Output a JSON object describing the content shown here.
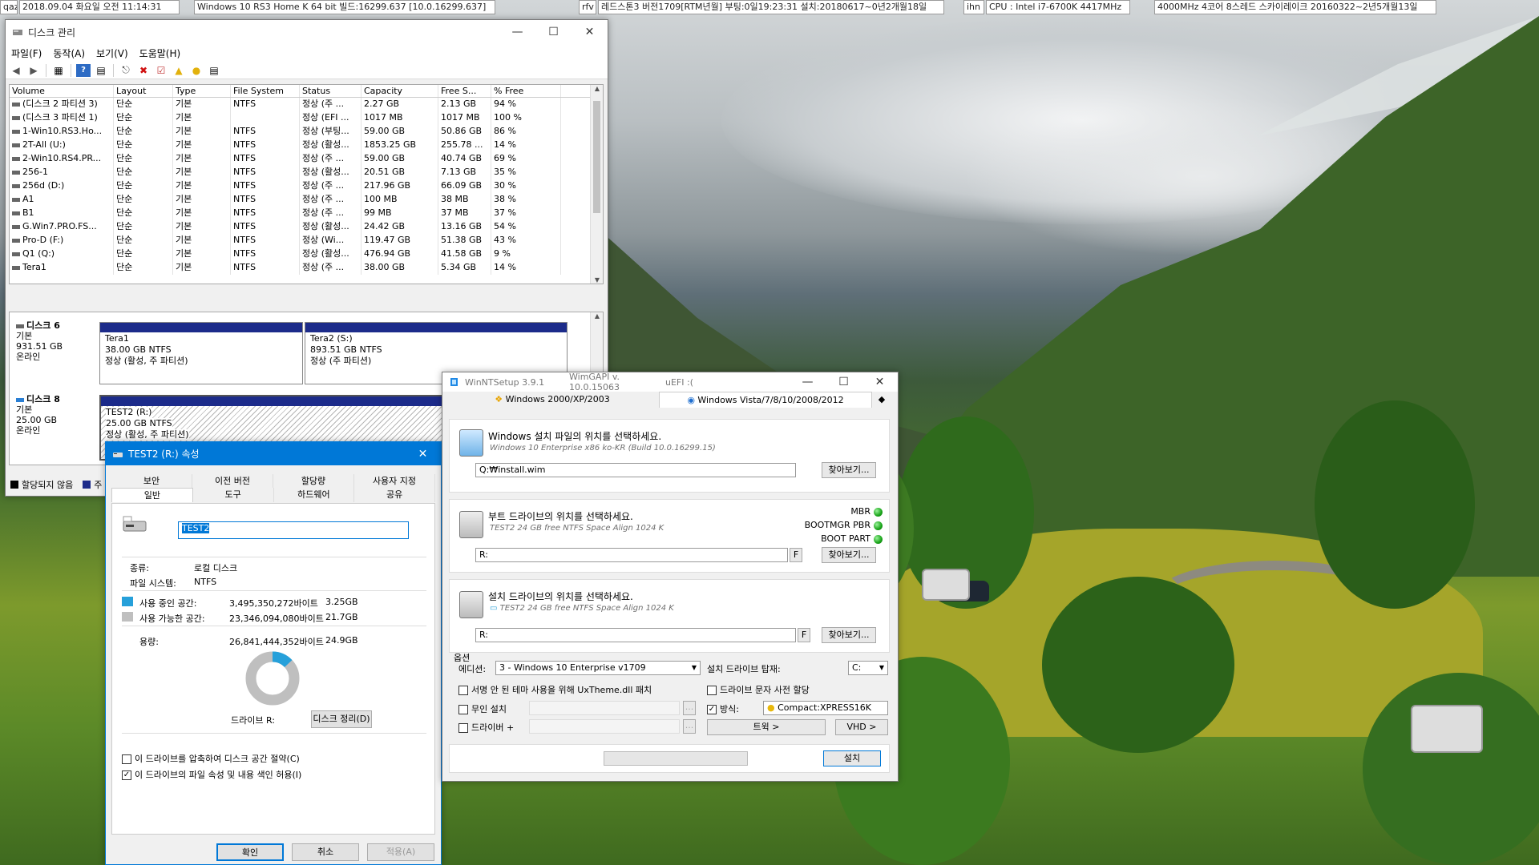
{
  "topbar": {
    "datetime": "2018.09.04 화요일 오전 11:14:31",
    "os": "Windows 10 RS3 Home K 64 bit 빌드:16299.637 [10.0.16299.637]",
    "rfv": "rfv",
    "redstone": "레드스톤3 버전1709[RTM년월] 부팅:0일19:23:31 설치:20180617~0년2개월18일",
    "user": "ihn",
    "cpu": "CPU : Intel i7-6700K 4417MHz",
    "cpu2": "4000MHz 4코어 8스레드 스카이레이크 20160322~2년5개월13일",
    "qaz": "qaz"
  },
  "disk_mgmt": {
    "title": "디스크 관리",
    "menu": [
      "파일(F)",
      "동작(A)",
      "보기(V)",
      "도움말(H)"
    ],
    "columns": [
      "Volume",
      "Layout",
      "Type",
      "File System",
      "Status",
      "Capacity",
      "Free S...",
      "% Free"
    ],
    "rows": [
      [
        "(디스크 2 파티션 3)",
        "단순",
        "기본",
        "NTFS",
        "정상 (주 ...",
        "2.27 GB",
        "2.13 GB",
        "94 %"
      ],
      [
        "(디스크 3 파티션 1)",
        "단순",
        "기본",
        "",
        "정상 (EFI ...",
        "1017 MB",
        "1017 MB",
        "100 %"
      ],
      [
        "1-Win10.RS3.Ho...",
        "단순",
        "기본",
        "NTFS",
        "정상 (부팅...",
        "59.00 GB",
        "50.86 GB",
        "86 %"
      ],
      [
        "2T-All (U:)",
        "단순",
        "기본",
        "NTFS",
        "정상 (활성...",
        "1853.25 GB",
        "255.78 ...",
        "14 %"
      ],
      [
        "2-Win10.RS4.PR...",
        "단순",
        "기본",
        "NTFS",
        "정상 (주 ...",
        "59.00 GB",
        "40.74 GB",
        "69 %"
      ],
      [
        "256-1",
        "단순",
        "기본",
        "NTFS",
        "정상 (활성...",
        "20.51 GB",
        "7.13 GB",
        "35 %"
      ],
      [
        "256d (D:)",
        "단순",
        "기본",
        "NTFS",
        "정상 (주 ...",
        "217.96 GB",
        "66.09 GB",
        "30 %"
      ],
      [
        "A1",
        "단순",
        "기본",
        "NTFS",
        "정상 (주 ...",
        "100 MB",
        "38 MB",
        "38 %"
      ],
      [
        "B1",
        "단순",
        "기본",
        "NTFS",
        "정상 (주 ...",
        "99 MB",
        "37 MB",
        "37 %"
      ],
      [
        "G.Win7.PRO.FS...",
        "단순",
        "기본",
        "NTFS",
        "정상 (활성...",
        "24.42 GB",
        "13.16 GB",
        "54 %"
      ],
      [
        "Pro-D (F:)",
        "단순",
        "기본",
        "NTFS",
        "정상 (Wi...",
        "119.47 GB",
        "51.38 GB",
        "43 %"
      ],
      [
        "Q1 (Q:)",
        "단순",
        "기본",
        "NTFS",
        "정상 (활성...",
        "476.94 GB",
        "41.58 GB",
        "9 %"
      ],
      [
        "Tera1",
        "단순",
        "기본",
        "NTFS",
        "정상 (주 ...",
        "38.00 GB",
        "5.34 GB",
        "14 %"
      ]
    ],
    "disk6": {
      "name": "디스크 6",
      "type": "기본",
      "size": "931.51 GB",
      "state": "온라인",
      "p1": {
        "name": "Tera1",
        "size": "38.00 GB NTFS",
        "status": "정상 (활성, 주 파티션)"
      },
      "p2": {
        "name": "Tera2  (S:)",
        "size": "893.51 GB NTFS",
        "status": "정상 (주 파티션)"
      }
    },
    "disk8": {
      "name": "디스크 8",
      "type": "기본",
      "size": "25.00 GB",
      "state": "온라인",
      "p1": {
        "name": "TEST2  (R:)",
        "size": "25.00 GB NTFS",
        "status": "정상 (활성, 주 파티션)"
      }
    },
    "legend_unalloc": "할당되지 않음",
    "legend_main": "주"
  },
  "props": {
    "title": "TEST2 (R:) 속성",
    "tabs_row1": [
      "보안",
      "이전 버전",
      "할당량",
      "사용자 지정"
    ],
    "tabs_row2": [
      "일반",
      "도구",
      "하드웨어",
      "공유"
    ],
    "name_value": "TEST2",
    "type_label": "종류:",
    "type_value": "로컬 디스크",
    "fs_label": "파일 시스템:",
    "fs_value": "NTFS",
    "used_label": "사용 중인 공간:",
    "used_bytes": "3,495,350,272바이트",
    "used_gb": "3.25GB",
    "free_label": "사용 가능한 공간:",
    "free_bytes": "23,346,094,080바이트",
    "free_gb": "21.7GB",
    "cap_label": "용량:",
    "cap_bytes": "26,841,444,352바이트",
    "cap_gb": "24.9GB",
    "drive_label": "드라이브 R:",
    "cleanup": "디스크 정리(D)",
    "compress": "이 드라이브를 압축하여 디스크 공간 절약(C)",
    "index": "이 드라이브의 파일 속성 및 내용 색인 허용(I)",
    "ok": "확인",
    "cancel": "취소",
    "apply": "적용(A)",
    "used_fraction": 0.13,
    "used_color": "#26a0da",
    "free_color": "#bfbfbf"
  },
  "wnt": {
    "title": "WinNTSetup 3.9.1",
    "api": "WimGAPI v. 10.0.15063",
    "uefi": "uEFI :(",
    "tab_xp": "Windows 2000/XP/2003",
    "tab_vista": "Windows Vista/7/8/10/2008/2012",
    "src_title": "Windows 설치 파일의 위치를 선택하세요.",
    "src_info": "Windows 10 Enterprise x86 ko-KR (Build 10.0.16299.15)",
    "src_path": "Q:₩install.wim",
    "browse": "찾아보기...",
    "boot_title": "부트 드라이브의 위치를 선택하세요.",
    "boot_info": "TEST2 24 GB free NTFS Space Align 1024 K",
    "boot_path": "R:",
    "mbr": "MBR",
    "bootmgr": "BOOTMGR PBR",
    "bootpart": "BOOT PART",
    "inst_title": "설치 드라이브의 위치를 선택하세요.",
    "inst_info": "TEST2 24 GB free NTFS Space Align 1024 K",
    "inst_path": "R:",
    "f": "F",
    "options": "옵션",
    "edition_label": "에디션:",
    "edition_value": "3 - Windows 10 Enterprise v1709",
    "mount_label": "설치 드라이브 탑재:",
    "mount_value": "C:",
    "uxtheme": "서명 안 된 테마 사용을 위해 UxTheme.dll 패치",
    "prealloc": "드라이브 문자 사전 할당",
    "unattended": "무인 설치",
    "mode_label": "방식:",
    "mode_value": "Compact:XPRESS16K",
    "drivers": "드라이버 +",
    "tweaks": "트윅 >",
    "vhd": "VHD >",
    "setup": "설치"
  }
}
